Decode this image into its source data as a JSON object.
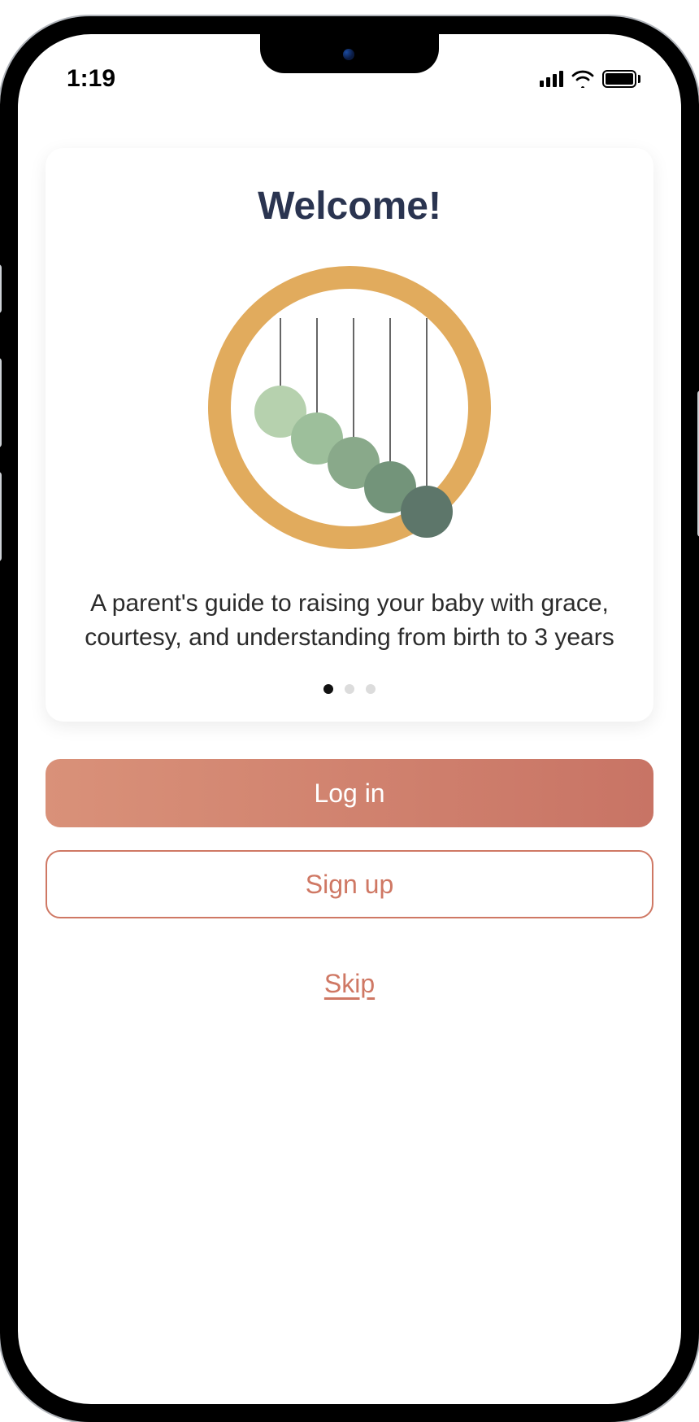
{
  "statusBar": {
    "time": "1:19"
  },
  "card": {
    "title": "Welcome!",
    "description": "A parent's guide to raising your baby with grace, courtesy, and understanding from birth to 3 years",
    "pager": {
      "count": 3,
      "activeIndex": 0
    }
  },
  "actions": {
    "loginLabel": "Log in",
    "signupLabel": "Sign up",
    "skipLabel": "Skip"
  },
  "colors": {
    "titleColor": "#2a3450",
    "accent": "#cf7864",
    "illustrationRing": "#e1ab5d",
    "pendulumColors": [
      "#b6d1ae",
      "#9dbf9b",
      "#89a98a",
      "#73947a",
      "#5d766a"
    ]
  }
}
